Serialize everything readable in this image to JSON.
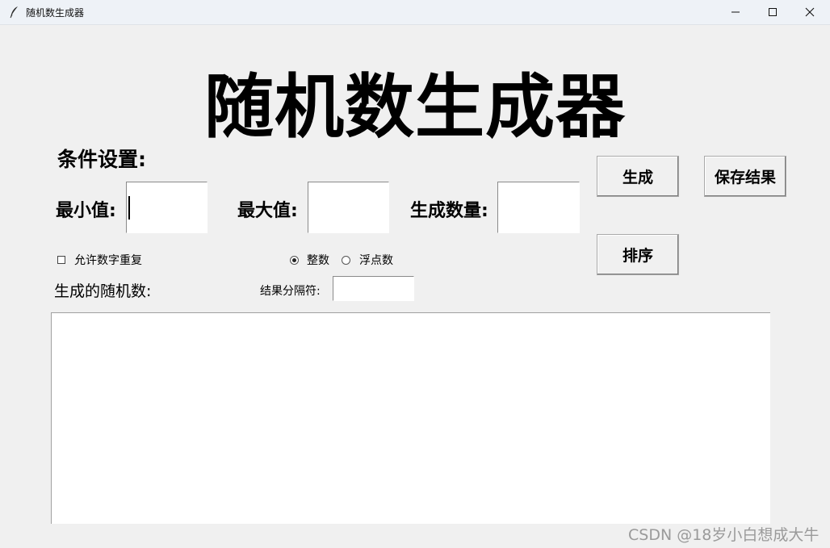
{
  "window": {
    "title": "随机数生成器",
    "controls": [
      "minimize-icon",
      "maximize-icon",
      "close-icon"
    ]
  },
  "header": {
    "title": "随机数生成器"
  },
  "conditions": {
    "section_label": "条件设置:",
    "min_label": "最小值:",
    "min_value": "",
    "max_label": "最大值:",
    "max_value": "",
    "count_label": "生成数量:",
    "count_value": ""
  },
  "buttons": {
    "generate": "生成",
    "save": "保存结果",
    "sort": "排序"
  },
  "options": {
    "allow_repeat_label": "允许数字重复",
    "allow_repeat_checked": false,
    "number_type": {
      "options": [
        "整数",
        "浮点数"
      ],
      "selected": "整数"
    }
  },
  "results": {
    "label": "生成的随机数:",
    "separator_label": "结果分隔符:",
    "separator_value": "",
    "content": ""
  },
  "watermark": "CSDN @18岁小白想成大牛"
}
